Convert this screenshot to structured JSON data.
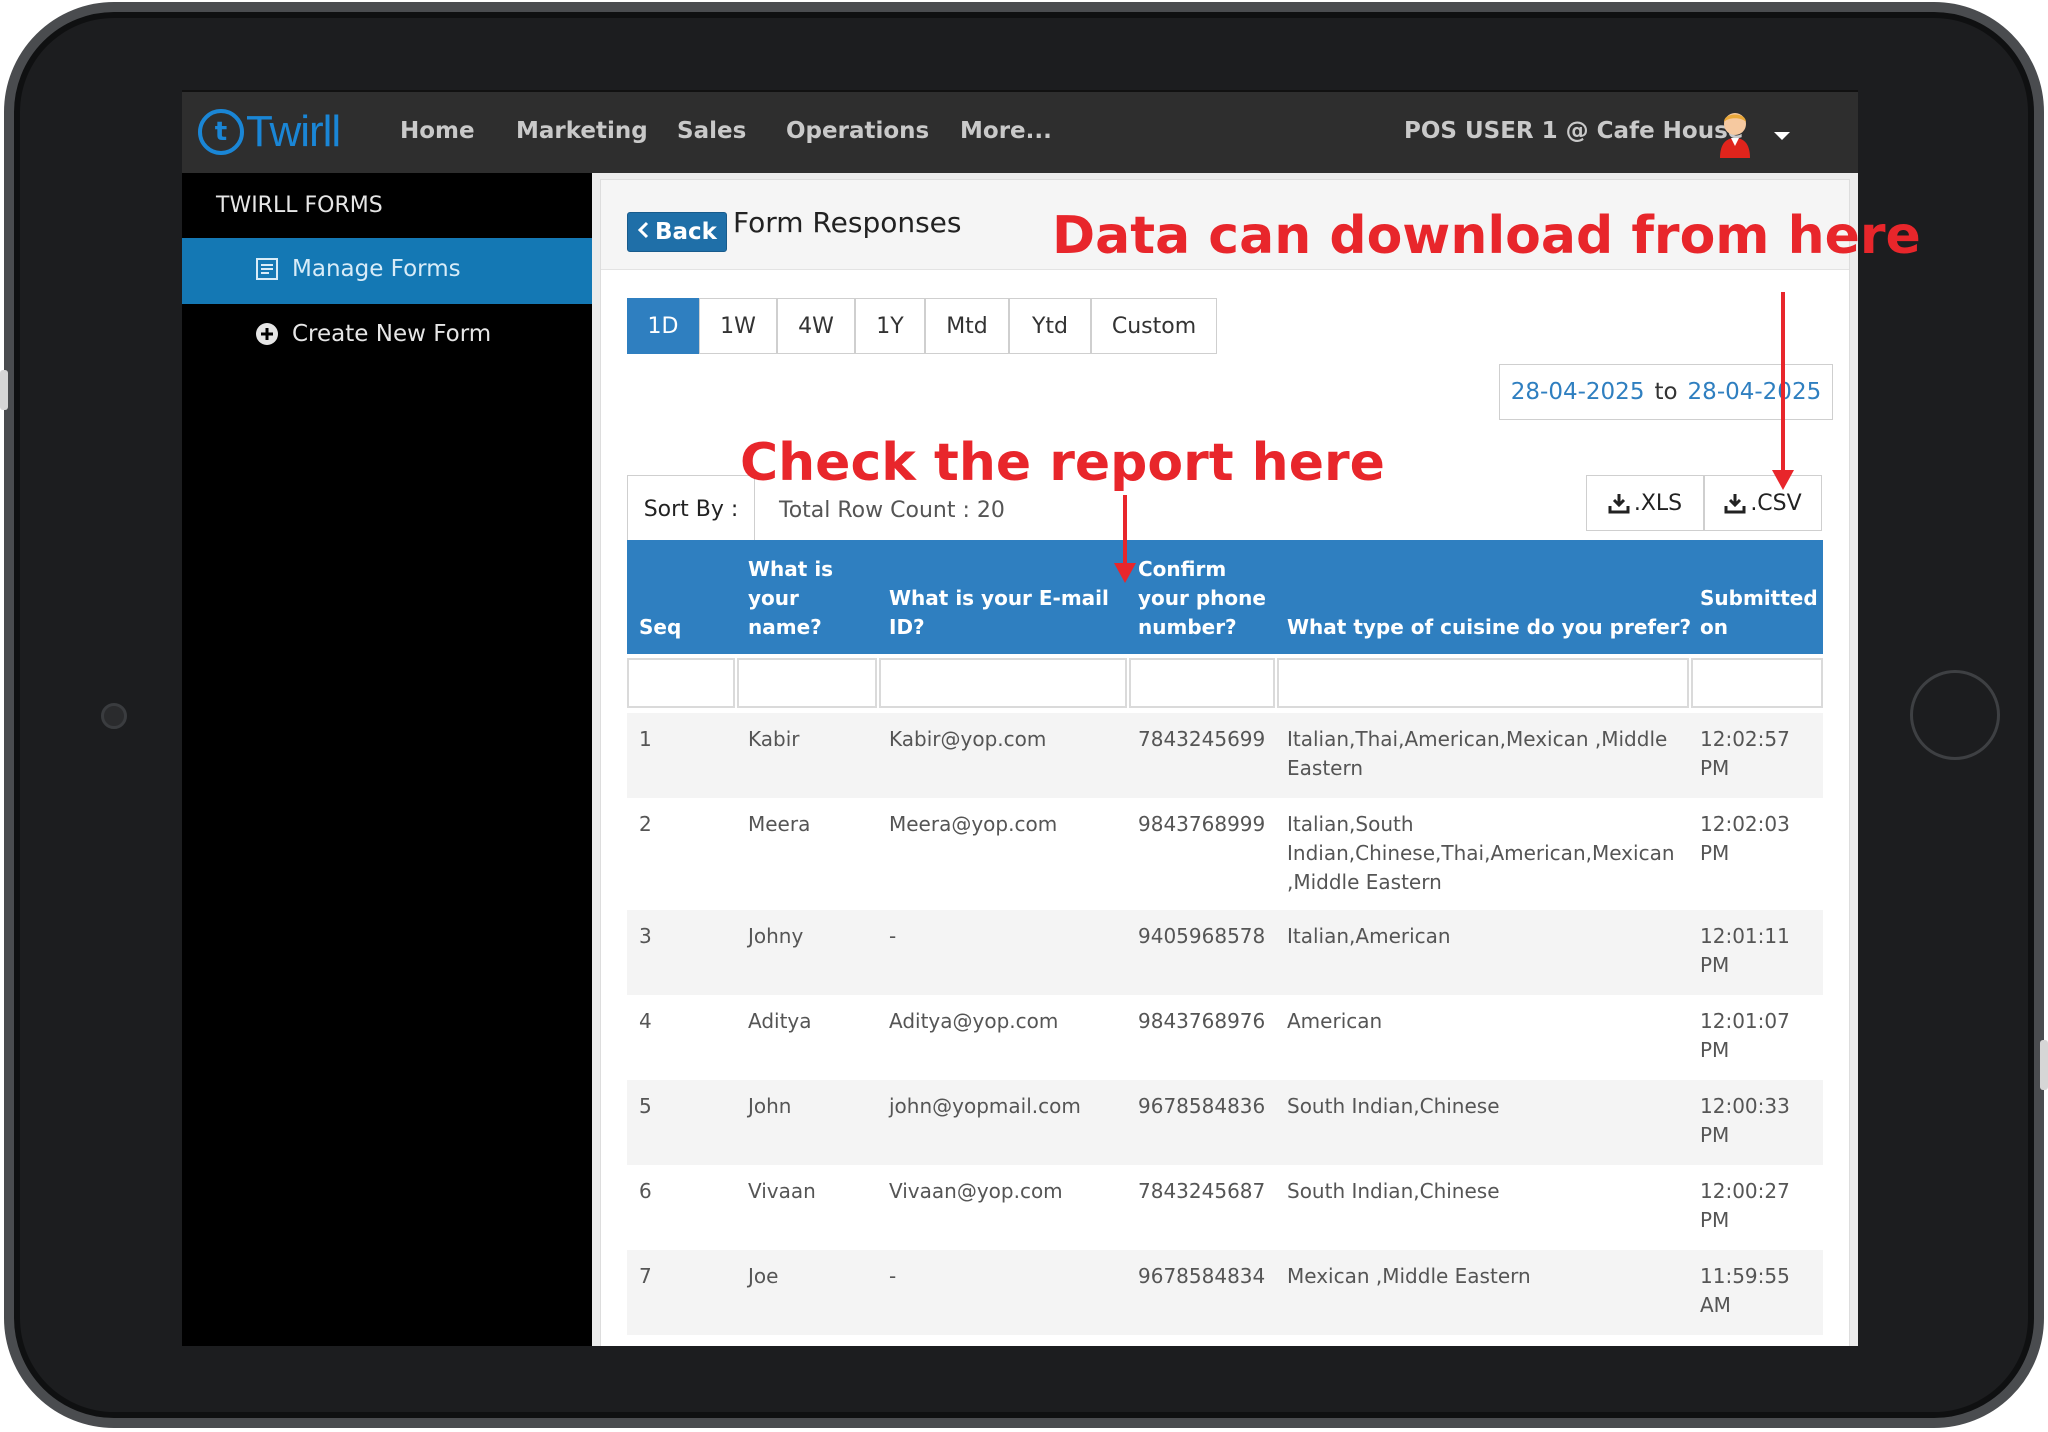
{
  "navbar": {
    "logo_mark": "t",
    "logo_text": "Twirll",
    "items": [
      "Home",
      "Marketing",
      "Sales",
      "Operations",
      "More..."
    ],
    "user": "POS USER 1 @ Cafe House"
  },
  "sidebar": {
    "title": "TWIRLL FORMS",
    "items": [
      {
        "label": "Manage Forms",
        "icon": "form-icon",
        "active": true
      },
      {
        "label": "Create New Form",
        "icon": "plus-circle-icon",
        "active": false
      }
    ]
  },
  "header": {
    "back_label": "Back",
    "title": "Form Responses"
  },
  "ranges": [
    "1D",
    "1W",
    "4W",
    "1Y",
    "Mtd",
    "Ytd",
    "Custom"
  ],
  "active_range": "1D",
  "date_range": {
    "from": "28-04-2025",
    "to_label": "to",
    "to": "28-04-2025"
  },
  "toolbar": {
    "sort_label": "Sort By :",
    "row_count": "Total Row Count : 20",
    "xls_label": ".XLS",
    "csv_label": ".CSV"
  },
  "table": {
    "headers": {
      "seq": "Seq",
      "name": [
        "What is",
        "your",
        "name?"
      ],
      "email": [
        "What is your E-mail",
        "ID?"
      ],
      "phone": [
        "Confirm",
        "your phone",
        "number?"
      ],
      "cuisine": "What type of cuisine do you prefer?",
      "submitted": [
        "Submitted",
        "on"
      ]
    },
    "rows": [
      {
        "seq": "1",
        "name": "Kabir",
        "email": "Kabir@yop.com",
        "phone": "7843245699",
        "cuisine": [
          "Italian,Thai,American,Mexican ,Middle",
          "Eastern"
        ],
        "submitted": [
          "12:02:57",
          "PM"
        ]
      },
      {
        "seq": "2",
        "name": "Meera",
        "email": "Meera@yop.com",
        "phone": "9843768999",
        "cuisine": [
          "Italian,South",
          "Indian,Chinese,Thai,American,Mexican",
          ",Middle Eastern"
        ],
        "submitted": [
          "12:02:03",
          "PM"
        ]
      },
      {
        "seq": "3",
        "name": "Johny",
        "email": "-",
        "phone": "9405968578",
        "cuisine": [
          "Italian,American"
        ],
        "submitted": [
          "12:01:11",
          "PM"
        ]
      },
      {
        "seq": "4",
        "name": "Aditya",
        "email": "Aditya@yop.com",
        "phone": "9843768976",
        "cuisine": [
          "American"
        ],
        "submitted": [
          "12:01:07",
          "PM"
        ]
      },
      {
        "seq": "5",
        "name": "John",
        "email": "john@yopmail.com",
        "phone": "9678584836",
        "cuisine": [
          "South Indian,Chinese"
        ],
        "submitted": [
          "12:00:33",
          "PM"
        ]
      },
      {
        "seq": "6",
        "name": "Vivaan",
        "email": "Vivaan@yop.com",
        "phone": "7843245687",
        "cuisine": [
          "South Indian,Chinese"
        ],
        "submitted": [
          "12:00:27",
          "PM"
        ]
      },
      {
        "seq": "7",
        "name": "Joe",
        "email": "-",
        "phone": "9678584834",
        "cuisine": [
          "Mexican ,Middle Eastern"
        ],
        "submitted": [
          "11:59:55",
          "AM"
        ]
      }
    ]
  },
  "annotations": {
    "download": "Data can download from here",
    "report": "Check the report here"
  },
  "colors": {
    "accent": "#2f7fc0",
    "sidebar_active": "#1478b4",
    "annotation": "#e8262b",
    "navbar": "#2e2e2e"
  }
}
